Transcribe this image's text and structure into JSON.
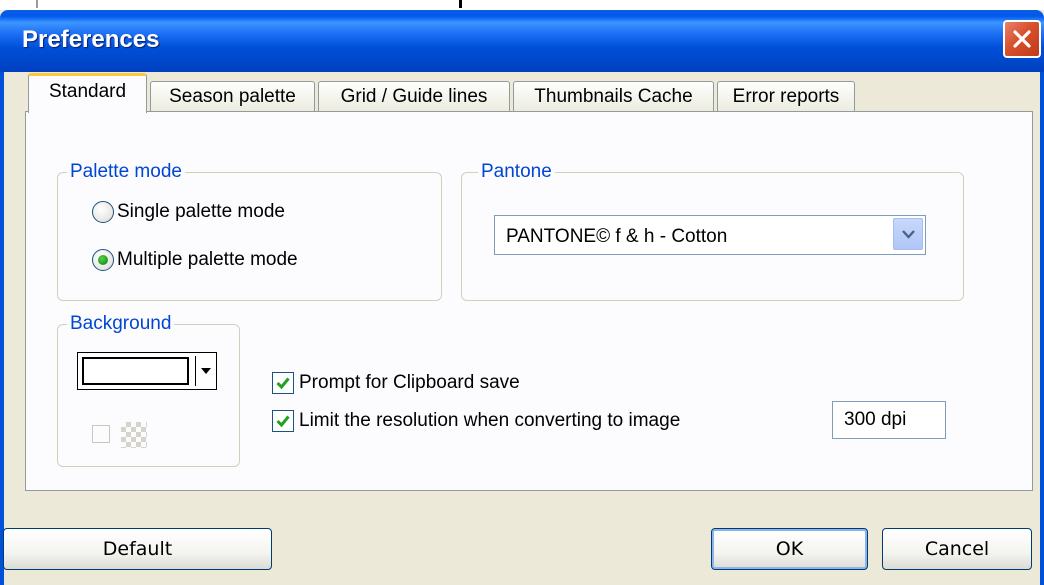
{
  "window": {
    "title": "Preferences"
  },
  "tabs": [
    {
      "label": "Standard",
      "active": true
    },
    {
      "label": "Season palette",
      "active": false
    },
    {
      "label": "Grid / Guide lines",
      "active": false
    },
    {
      "label": "Thumbnails Cache",
      "active": false
    },
    {
      "label": "Error reports",
      "active": false
    }
  ],
  "palette_mode": {
    "legend": "Palette mode",
    "options": [
      {
        "label": "Single palette mode",
        "selected": false
      },
      {
        "label": "Multiple palette mode",
        "selected": true
      }
    ]
  },
  "pantone": {
    "legend": "Pantone",
    "selected": "PANTONE© f & h - Cotton"
  },
  "background": {
    "legend": "Background",
    "color": "#ffffff",
    "transparent_checked": false
  },
  "options": {
    "clipboard_label": "Prompt for Clipboard save",
    "clipboard_checked": true,
    "limit_label": "Limit the resolution when converting to image",
    "limit_checked": true,
    "resolution": "300 dpi"
  },
  "buttons": {
    "default": "Default",
    "ok": "OK",
    "cancel": "Cancel"
  },
  "colors": {
    "titlebar": "#0050d8",
    "legend_text": "#0046d5",
    "check_green": "#21a121",
    "active_tab_accent": "#ffc83c"
  }
}
